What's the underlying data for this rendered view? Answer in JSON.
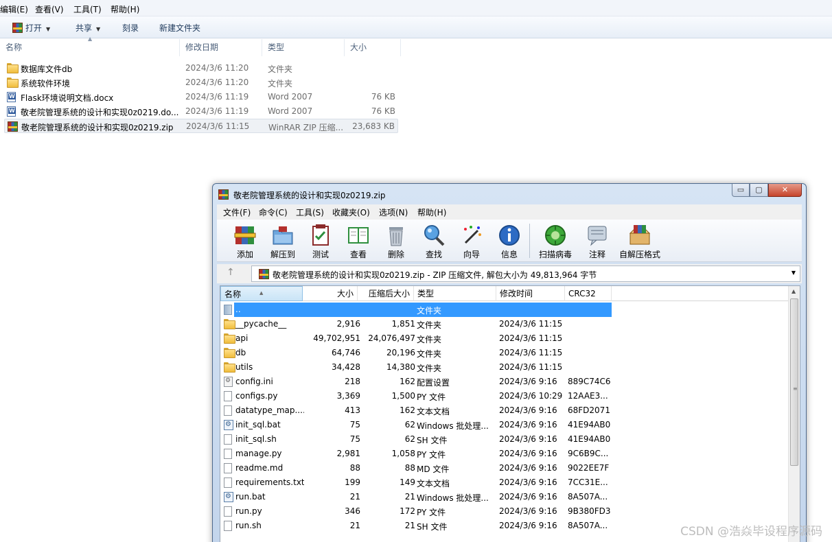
{
  "explorer": {
    "menu": [
      "编辑(E)",
      "查看(V)",
      "工具(T)",
      "帮助(H)"
    ],
    "toolbar": {
      "open": "打开",
      "share": "共享",
      "burn": "刻录",
      "new_folder": "新建文件夹"
    },
    "columns": {
      "name": "名称",
      "date": "修改日期",
      "type": "类型",
      "size": "大小"
    },
    "rows": [
      {
        "icon": "folder-icon",
        "name": "数据库文件db",
        "date": "2024/3/6 11:20",
        "type": "文件夹",
        "size": ""
      },
      {
        "icon": "folder-icon",
        "name": "系统软件环境",
        "date": "2024/3/6 11:20",
        "type": "文件夹",
        "size": ""
      },
      {
        "icon": "word-doc-icon",
        "name": "Flask环境说明文档.docx",
        "date": "2024/3/6 11:19",
        "type": "Word 2007",
        "size": "76 KB"
      },
      {
        "icon": "word-doc-icon",
        "name": "敬老院管理系统的设计和实现0z0219.do...",
        "date": "2024/3/6 11:19",
        "type": "Word 2007",
        "size": "76 KB"
      },
      {
        "icon": "winrar-archive-icon",
        "name": "敬老院管理系统的设计和实现0z0219.zip",
        "date": "2024/3/6 11:15",
        "type": "WinRAR ZIP 压缩...",
        "size": "23,683 KB"
      }
    ]
  },
  "winrar": {
    "title": "敬老院管理系统的设计和实现0z0219.zip",
    "window_buttons": {
      "minimize": "▭",
      "maximize": "▢",
      "close": "✕"
    },
    "menu": [
      "文件(F)",
      "命令(C)",
      "工具(S)",
      "收藏夹(O)",
      "选项(N)",
      "帮助(H)"
    ],
    "tools": [
      {
        "label": "添加",
        "icon": "add-archive-icon"
      },
      {
        "label": "解压到",
        "icon": "extract-to-icon"
      },
      {
        "label": "测试",
        "icon": "test-icon"
      },
      {
        "label": "查看",
        "icon": "view-icon"
      },
      {
        "label": "删除",
        "icon": "delete-icon"
      },
      {
        "label": "查找",
        "icon": "find-icon"
      },
      {
        "label": "向导",
        "icon": "wizard-icon"
      },
      {
        "label": "信息",
        "icon": "info-icon"
      },
      {
        "label": "扫描病毒",
        "icon": "virus-scan-icon"
      },
      {
        "label": "注释",
        "icon": "comment-icon"
      },
      {
        "label": "自解压格式",
        "icon": "sfx-icon"
      }
    ],
    "path": "敬老院管理系统的设计和实现0z0219.zip - ZIP 压缩文件, 解包大小为 49,813,964 字节",
    "columns": {
      "name": "名称",
      "size": "大小",
      "packed": "压缩后大小",
      "type": "类型",
      "modified": "修改时间",
      "crc": "CRC32"
    },
    "rows": [
      {
        "icon": "up-folder-icon",
        "name": "..",
        "size": "",
        "packed": "",
        "type": "文件夹",
        "modified": "",
        "crc": "",
        "selected": true
      },
      {
        "icon": "folder-icon",
        "name": "__pycache__",
        "size": "2,916",
        "packed": "1,851",
        "type": "文件夹",
        "modified": "2024/3/6 11:15",
        "crc": ""
      },
      {
        "icon": "folder-icon",
        "name": "api",
        "size": "49,702,951",
        "packed": "24,076,497",
        "type": "文件夹",
        "modified": "2024/3/6 11:15",
        "crc": ""
      },
      {
        "icon": "folder-icon",
        "name": "db",
        "size": "64,746",
        "packed": "20,196",
        "type": "文件夹",
        "modified": "2024/3/6 11:15",
        "crc": ""
      },
      {
        "icon": "folder-icon",
        "name": "utils",
        "size": "34,428",
        "packed": "14,380",
        "type": "文件夹",
        "modified": "2024/3/6 11:15",
        "crc": ""
      },
      {
        "icon": "config-file-icon",
        "name": "config.ini",
        "size": "218",
        "packed": "162",
        "type": "配置设置",
        "modified": "2024/3/6 9:16",
        "crc": "889C74C6"
      },
      {
        "icon": "file-icon",
        "name": "configs.py",
        "size": "3,369",
        "packed": "1,500",
        "type": "PY 文件",
        "modified": "2024/3/6 10:29",
        "crc": "12AAE3..."
      },
      {
        "icon": "file-icon",
        "name": "datatype_map....",
        "size": "413",
        "packed": "162",
        "type": "文本文档",
        "modified": "2024/3/6 9:16",
        "crc": "68FD2071"
      },
      {
        "icon": "batch-file-icon",
        "name": "init_sql.bat",
        "size": "75",
        "packed": "62",
        "type": "Windows 批处理...",
        "modified": "2024/3/6 9:16",
        "crc": "41E94AB0"
      },
      {
        "icon": "file-icon",
        "name": "init_sql.sh",
        "size": "75",
        "packed": "62",
        "type": "SH 文件",
        "modified": "2024/3/6 9:16",
        "crc": "41E94AB0"
      },
      {
        "icon": "file-icon",
        "name": "manage.py",
        "size": "2,981",
        "packed": "1,058",
        "type": "PY 文件",
        "modified": "2024/3/6 9:16",
        "crc": "9C6B9C..."
      },
      {
        "icon": "file-icon",
        "name": "readme.md",
        "size": "88",
        "packed": "88",
        "type": "MD 文件",
        "modified": "2024/3/6 9:16",
        "crc": "9022EE7F"
      },
      {
        "icon": "file-icon",
        "name": "requirements.txt",
        "size": "199",
        "packed": "149",
        "type": "文本文档",
        "modified": "2024/3/6 9:16",
        "crc": "7CC31E..."
      },
      {
        "icon": "batch-file-icon",
        "name": "run.bat",
        "size": "21",
        "packed": "21",
        "type": "Windows 批处理...",
        "modified": "2024/3/6 9:16",
        "crc": "8A507A..."
      },
      {
        "icon": "file-icon",
        "name": "run.py",
        "size": "346",
        "packed": "172",
        "type": "PY 文件",
        "modified": "2024/3/6 9:16",
        "crc": "9B380FD3"
      },
      {
        "icon": "file-icon",
        "name": "run.sh",
        "size": "21",
        "packed": "21",
        "type": "SH 文件",
        "modified": "2024/3/6 9:16",
        "crc": "8A507A..."
      }
    ]
  },
  "watermark": "CSDN @浩焱毕设程序源码"
}
